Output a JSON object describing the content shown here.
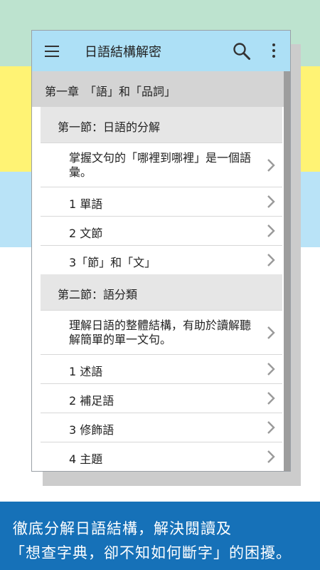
{
  "app": {
    "title": "日語結構解密"
  },
  "chapter": {
    "title": "第一章　「語」和「品詞」"
  },
  "sections": [
    {
      "title": "第一節：日語的分解",
      "items": [
        {
          "text": "掌握文句的「哪裡到哪裡」是一個語彙。",
          "kind": "desc"
        },
        {
          "text": "1 單語",
          "kind": "simple"
        },
        {
          "text": "2 文節",
          "kind": "simple"
        },
        {
          "text": "3「節」和「文」",
          "kind": "simple"
        }
      ]
    },
    {
      "title": "第二節：語分類",
      "items": [
        {
          "text": "理解日語的整體結構，有助於讀解聽解簡單的單一文句。",
          "kind": "desc"
        },
        {
          "text": "1 述語",
          "kind": "simple"
        },
        {
          "text": "2 補足語",
          "kind": "simple"
        },
        {
          "text": "3 修飾語",
          "kind": "simple"
        },
        {
          "text": "4 主題",
          "kind": "simple"
        }
      ]
    }
  ],
  "promo": {
    "line1": "徹底分解日語結構，解決閱讀及",
    "line2": "「想查字典，卻不知如何斷字」的困擾。"
  },
  "icons": {
    "menu": "hamburger-menu-icon",
    "search": "search-icon",
    "more": "more-vert-icon",
    "chevron": "chevron-right-icon"
  },
  "colors": {
    "appbar": "#ade0f6",
    "footer": "#1671b8",
    "chapter_bg": "#d4d4d4",
    "section_bg": "#e6e6e6"
  }
}
